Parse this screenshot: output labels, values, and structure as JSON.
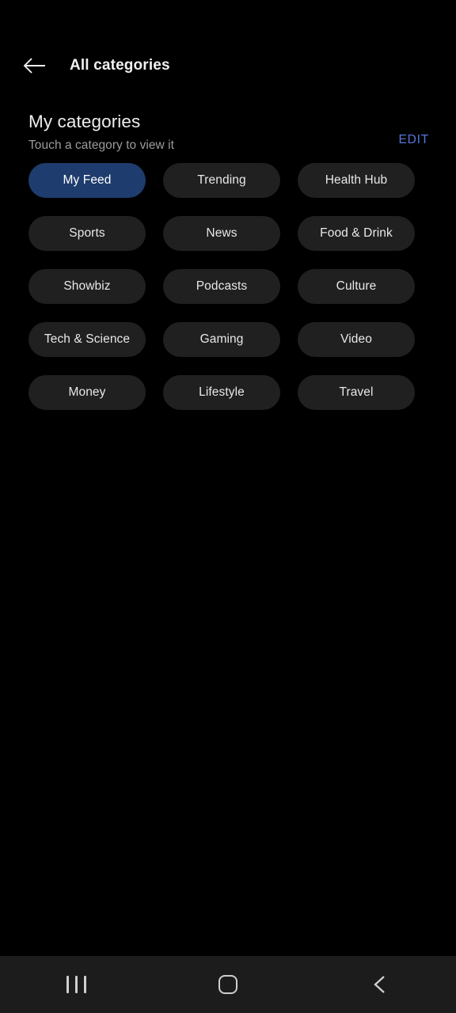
{
  "status_bar": {
    "visible": true
  },
  "app_bar": {
    "back_icon": "arrow-left-icon",
    "title": "All categories"
  },
  "section": {
    "title": "My categories",
    "subtitle": "Touch a category to view it",
    "edit_label": "EDIT",
    "edit_color": "#5577dd"
  },
  "categories": [
    {
      "label": "My Feed",
      "selected": true
    },
    {
      "label": "Trending",
      "selected": false
    },
    {
      "label": "Health Hub",
      "selected": false
    },
    {
      "label": "Sports",
      "selected": false
    },
    {
      "label": "News",
      "selected": false
    },
    {
      "label": "Food & Drink",
      "selected": false
    },
    {
      "label": "Showbiz",
      "selected": false
    },
    {
      "label": "Podcasts",
      "selected": false
    },
    {
      "label": "Culture",
      "selected": false
    },
    {
      "label": "Tech & Science",
      "selected": false
    },
    {
      "label": "Gaming",
      "selected": false
    },
    {
      "label": "Video",
      "selected": false
    },
    {
      "label": "Money",
      "selected": false
    },
    {
      "label": "Lifestyle",
      "selected": false
    },
    {
      "label": "Travel",
      "selected": false
    }
  ],
  "colors": {
    "page_background": "#000000",
    "chip_background": "#202020",
    "chip_selected_background": "#1e3c6d",
    "chip_text": "#e8e8e8",
    "nav_bar_background": "#1c1c1c",
    "nav_icon": "#cfcfcf",
    "subtitle_text": "#9b9b9b"
  },
  "nav_bar": {
    "items": [
      {
        "name": "recents-icon",
        "label": "Recents"
      },
      {
        "name": "home-icon",
        "label": "Home"
      },
      {
        "name": "back-icon",
        "label": "Back"
      }
    ]
  }
}
